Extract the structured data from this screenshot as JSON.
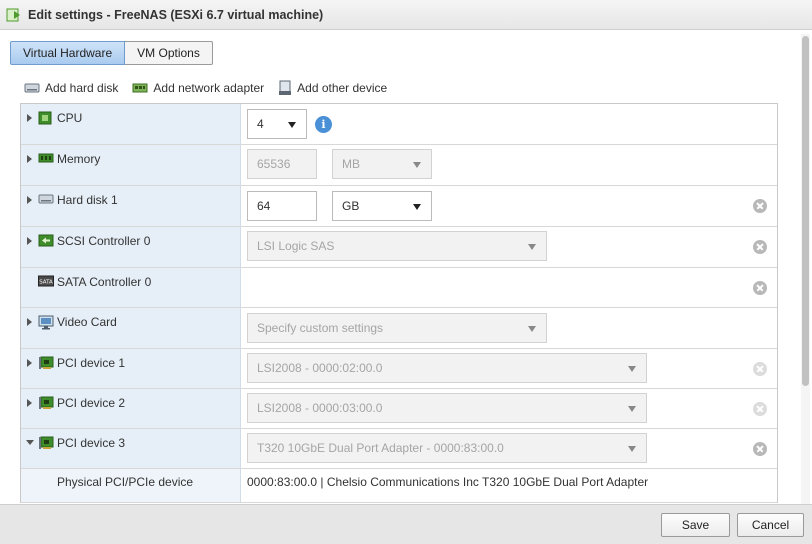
{
  "window": {
    "title": "Edit settings - FreeNAS (ESXi 6.7 virtual machine)"
  },
  "tabs": [
    {
      "label": "Virtual Hardware",
      "active": true
    },
    {
      "label": "VM Options",
      "active": false
    }
  ],
  "toolbar": {
    "add_hard_disk": "Add hard disk",
    "add_network_adapter": "Add network adapter",
    "add_other_device": "Add other device"
  },
  "devices": {
    "cpu": {
      "label": "CPU",
      "value": "4",
      "icon": "cpu-icon"
    },
    "memory": {
      "label": "Memory",
      "value": "65536",
      "unit": "MB",
      "icon": "memory-icon"
    },
    "hard_disk_1": {
      "label": "Hard disk 1",
      "value": "64",
      "unit": "GB",
      "icon": "hard-disk-icon"
    },
    "scsi_controller_0": {
      "label": "SCSI Controller 0",
      "value": "LSI Logic SAS",
      "icon": "scsi-icon"
    },
    "sata_controller_0": {
      "label": "SATA Controller 0",
      "icon": "sata-icon"
    },
    "video_card": {
      "label": "Video Card",
      "value": "Specify custom settings",
      "icon": "monitor-icon"
    },
    "pci_device_1": {
      "label": "PCI device 1",
      "value": "LSI2008 - 0000:02:00.0",
      "icon": "pci-card-icon"
    },
    "pci_device_2": {
      "label": "PCI device 2",
      "value": "LSI2008 - 0000:03:00.0",
      "icon": "pci-card-icon"
    },
    "pci_device_3": {
      "label": "PCI device 3",
      "value": "T320 10GbE Dual Port Adapter - 0000:83:00.0",
      "icon": "pci-card-icon",
      "expanded": true,
      "physical_label": "Physical PCI/PCIe device",
      "physical_value": "0000:83:00.0 | Chelsio Communications Inc T320 10GbE Dual Port Adapter"
    }
  },
  "footer": {
    "save_label": "Save",
    "cancel_label": "Cancel"
  },
  "colors": {
    "accent": "#4a90d6",
    "label_column": "#e6eff7",
    "active_tab": "#a9cbef"
  }
}
